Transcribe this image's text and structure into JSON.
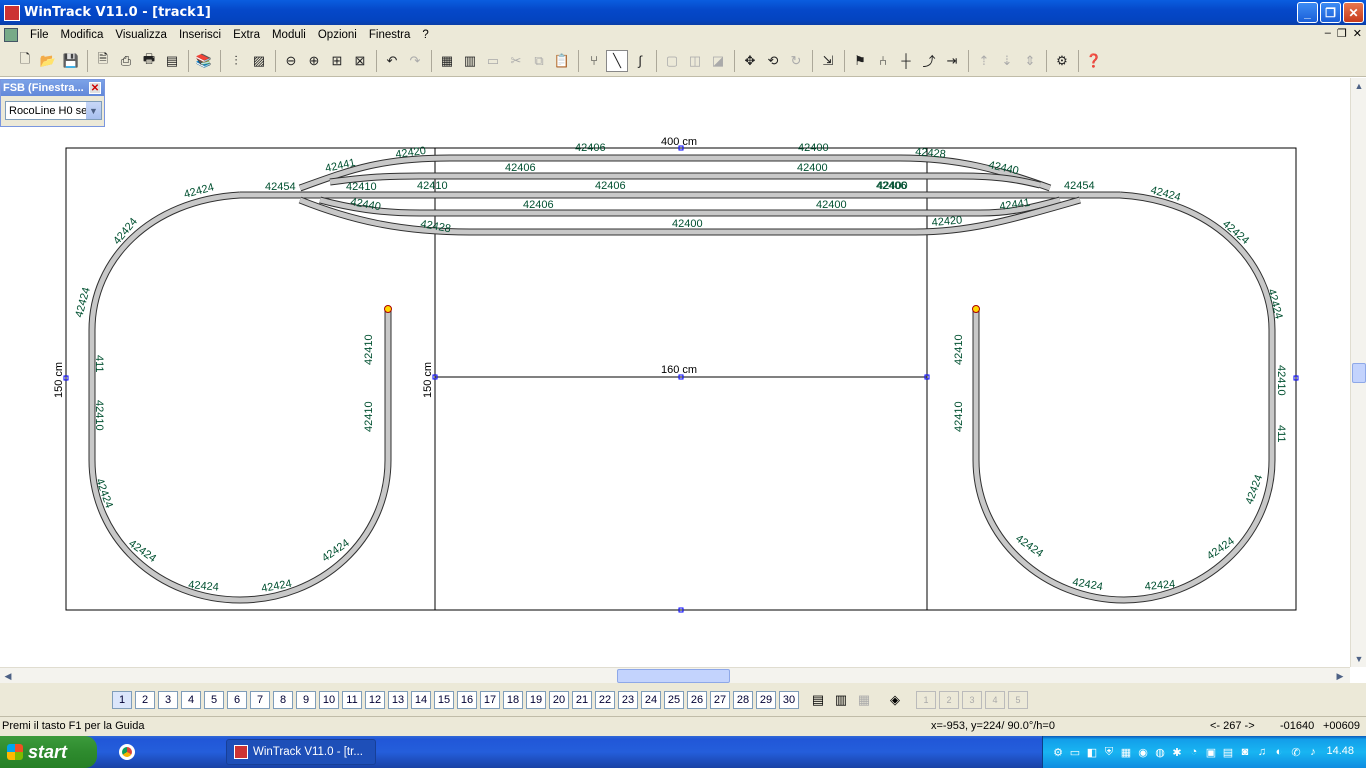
{
  "window": {
    "title": "WinTrack  V11.0 - [track1]",
    "minimize_glyph": "_",
    "maximize_glyph": "❐",
    "close_glyph": "✕"
  },
  "menu": {
    "items": [
      "File",
      "Modifica",
      "Visualizza",
      "Inserisci",
      "Extra",
      "Moduli",
      "Opzioni",
      "Finestra",
      "?"
    ],
    "mdi_controls": [
      "–",
      "❐",
      "✕"
    ]
  },
  "toolbar": {
    "icons": [
      "new-document-icon",
      "open-folder-icon",
      "save-icon",
      "|",
      "print-preview-icon",
      "print-icon",
      "print-setup-icon",
      "calculator-icon",
      "|",
      "library-icon",
      "|",
      "sliders-icon",
      "terrain-image-icon",
      "|",
      "zoom-out-icon",
      "zoom-in-icon",
      "zoom-window-icon",
      "zoom-fit-icon",
      "|",
      "undo-icon",
      "redo-icon",
      "|",
      "parts-list-icon",
      "cut-list-icon",
      "table-icon",
      "scissors-icon",
      "copy-icon",
      "paste-icon",
      "|",
      "track-insert-icon",
      "flex-track-icon",
      "curve-icon",
      "|",
      "group-icon",
      "ungroup-icon",
      "stack-icon",
      "|",
      "move-icon",
      "rotate-icon",
      "rotate-180-icon",
      "|",
      "align-icon",
      "|",
      "signal-icon",
      "switch-icon",
      "connect-icon",
      "join-icon",
      "split-icon",
      "|",
      "height-up-icon",
      "height-down-icon",
      "height-zero-icon",
      "|",
      "settings-icon",
      "|",
      "help-icon"
    ],
    "glyphs": {
      "new-document-icon": "🗋",
      "open-folder-icon": "📂",
      "save-icon": "💾",
      "print-preview-icon": "🗎",
      "print-icon": "⎙",
      "print-setup-icon": "🖶",
      "calculator-icon": "▤",
      "library-icon": "📚",
      "sliders-icon": "⫶",
      "terrain-image-icon": "▨",
      "zoom-out-icon": "⊖",
      "zoom-in-icon": "⊕",
      "zoom-window-icon": "⊞",
      "zoom-fit-icon": "⊠",
      "undo-icon": "↶",
      "redo-icon": "↷",
      "parts-list-icon": "▦",
      "cut-list-icon": "▥",
      "table-icon": "▭",
      "scissors-icon": "✂",
      "copy-icon": "⧉",
      "paste-icon": "📋",
      "track-insert-icon": "⑂",
      "flex-track-icon": "╲",
      "curve-icon": "∫",
      "group-icon": "▢",
      "ungroup-icon": "◫",
      "stack-icon": "◪",
      "move-icon": "✥",
      "rotate-icon": "⟲",
      "rotate-180-icon": "↻",
      "align-icon": "⇲",
      "signal-icon": "⚑",
      "switch-icon": "⑃",
      "connect-icon": "┼",
      "join-icon": "⤴",
      "split-icon": "⇥",
      "height-up-icon": "⇡",
      "height-down-icon": "⇣",
      "height-zero-icon": "⇕",
      "settings-icon": "⚙",
      "help-icon": "❓"
    },
    "disabled": [
      "redo-icon",
      "table-icon",
      "scissors-icon",
      "copy-icon",
      "paste-icon",
      "group-icon",
      "ungroup-icon",
      "stack-icon",
      "rotate-180-icon",
      "height-up-icon",
      "height-down-icon",
      "height-zero-icon"
    ],
    "pressed": [
      "flex-track-icon"
    ]
  },
  "fsb_panel": {
    "title": "FSB (Finestra...",
    "close_glyph": "✕",
    "selected_library": "RocoLine H0 se",
    "arrow_glyph": "▼"
  },
  "layout": {
    "dimension_top": "400 cm",
    "dimension_left": "150 cm",
    "dimension_center_vertical": "150 cm",
    "dimension_center_horizontal": "160 cm",
    "track_labels": {
      "left_loop": [
        "42424",
        "42424",
        "42424",
        "411",
        "42410",
        "42424",
        "42424",
        "42424",
        "42424",
        "42424",
        "42410",
        "42410"
      ],
      "right_loop": [
        "42424",
        "42424",
        "42424",
        "42410",
        "411",
        "42424",
        "42424",
        "42424",
        "42424",
        "42424",
        "42410",
        "42410"
      ],
      "yard": [
        "42420",
        "42441",
        "42454",
        "42410",
        "42410",
        "42440",
        "42406",
        "42406",
        "42406",
        "42406",
        "42400",
        "42400",
        "42400",
        "42400",
        "42406",
        "42400",
        "42428",
        "42440",
        "42454",
        "42441",
        "42420",
        "42428"
      ]
    },
    "colors": {
      "track_fill": "#c8c8c8",
      "track_edge": "#303030",
      "label": "#005030",
      "bumper": "#ffd700"
    }
  },
  "scrollbars": {
    "up_glyph": "▲",
    "down_glyph": "▼",
    "left_glyph": "◀",
    "right_glyph": "▶"
  },
  "layers": {
    "buttons": [
      "1",
      "2",
      "3",
      "4",
      "5",
      "6",
      "7",
      "8",
      "9",
      "10",
      "11",
      "12",
      "13",
      "14",
      "15",
      "16",
      "17",
      "18",
      "19",
      "20",
      "21",
      "22",
      "23",
      "24",
      "25",
      "26",
      "27",
      "28",
      "29",
      "30"
    ],
    "tool_glyphs": [
      "▤",
      "▥",
      "▦",
      "◈"
    ],
    "small_glyphs": [
      "1",
      "2",
      "3",
      "4",
      "5"
    ]
  },
  "statusbar": {
    "help_text": "Premi il tasto F1 per la Guida",
    "coords": "x=-953, y=224/ 90.0°/h=0",
    "segment": "<- 267 ->",
    "x_value": "-01640",
    "y_value": "+00609"
  },
  "taskbar": {
    "start_label": "start",
    "task_title": "WinTrack  V11.0 - [tr...",
    "time": "14.48",
    "tray_glyphs": [
      "⚙",
      "▭",
      "◧",
      "⛨",
      "▦",
      "◉",
      "◍",
      "✱",
      "◔",
      "▣",
      "▤",
      "◙",
      "♫",
      "◐",
      "✆",
      "♪"
    ]
  }
}
